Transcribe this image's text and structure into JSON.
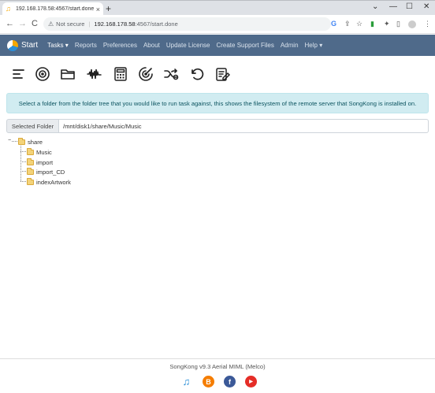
{
  "browser": {
    "tab_title": "192.168.178.58:4567/start.done",
    "new_tab": "+",
    "url_security": "Not secure",
    "url_host": "192.168.178.58",
    "url_path": ":4567/start.done",
    "controls": {
      "minimize": "—",
      "maximize": "☐",
      "close": "✕",
      "tab_close": "×",
      "back": "←",
      "forward": "→",
      "reload": "C"
    }
  },
  "app": {
    "brand": "Start",
    "menu": [
      {
        "label": "Tasks ▾"
      },
      {
        "label": "Reports"
      },
      {
        "label": "Preferences"
      },
      {
        "label": "About"
      },
      {
        "label": "Update License"
      },
      {
        "label": "Create Support Files"
      },
      {
        "label": "Admin"
      },
      {
        "label": "Help ▾"
      }
    ],
    "action_icons": [
      "status-icon",
      "fix-songs-icon",
      "folder-icon",
      "audio-waveform-icon",
      "calculator-icon",
      "radar-icon",
      "shuffle-icon",
      "undo-icon",
      "edit-list-icon"
    ]
  },
  "alert": {
    "text": "Select a folder from the folder tree that you would like to run task against, this shows the filesystem of the remote server that SongKong is installed on."
  },
  "folder": {
    "label": "Selected Folder",
    "value": "/mnt/disk1/share/Music/Music"
  },
  "tree": {
    "root": "share",
    "toggle": "−",
    "children": [
      "Music",
      "import",
      "import_CD",
      "indexArtwork"
    ]
  },
  "footer": {
    "version": "SongKong v9.3 Aerial MIML (Melco)",
    "social_icons": [
      "songkong-icon",
      "blogger-icon",
      "facebook-icon",
      "youtube-icon"
    ],
    "colors": {
      "blogger": "#f57d00",
      "facebook": "#3b5998",
      "youtube": "#e52d27"
    }
  }
}
